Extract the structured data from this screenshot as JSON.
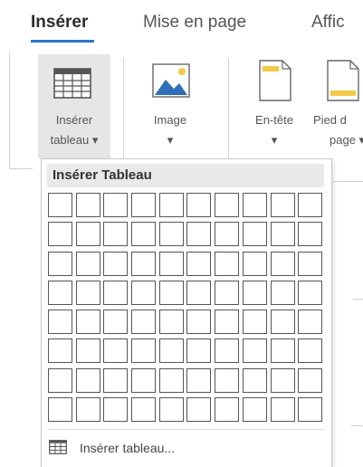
{
  "tabs": [
    {
      "label": "Insérer",
      "active": true
    },
    {
      "label": "Mise en page",
      "active": false
    },
    {
      "label": "Affic",
      "active": false
    }
  ],
  "ribbon": {
    "insert_table": {
      "line1": "Insérer",
      "line2": "tableau ▾",
      "icon": "table-icon"
    },
    "image": {
      "line1": "Image",
      "line2": "▾",
      "icon": "image-icon"
    },
    "header": {
      "line1": "En-tête",
      "line2": "▾",
      "icon": "header-icon"
    },
    "footer": {
      "line1": "Pied d",
      "line2": "page ▾",
      "icon": "footer-icon"
    }
  },
  "dropdown": {
    "title": "Insérer Tableau",
    "grid": {
      "columns": 10,
      "rows": 8
    },
    "insert_table_item": "Insérer tableau..."
  },
  "colors": {
    "accent": "#2b77c9",
    "image_icon_blue": "#2e6fb7",
    "header_icon_yellow": "#f3c94a",
    "header_band": "#f8e2a2"
  }
}
